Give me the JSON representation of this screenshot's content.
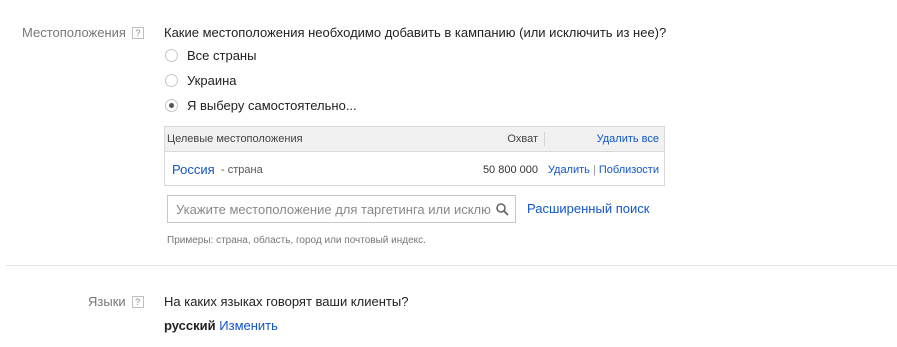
{
  "locations": {
    "label": "Местоположения",
    "help": "?",
    "question": "Какие местоположения необходимо добавить в кампанию (или исключить из нее)?",
    "options": [
      {
        "label": "Все страны",
        "selected": false
      },
      {
        "label": "Украина",
        "selected": false
      },
      {
        "label": "Я выберу самостоятельно...",
        "selected": true
      }
    ],
    "table": {
      "col_target": "Целевые местоположения",
      "col_reach": "Охват",
      "remove_all": "Удалить все",
      "rows": [
        {
          "name": "Россия",
          "type": "- страна",
          "reach": "50 800 000",
          "remove": "Удалить",
          "sep": "|",
          "nearby": "Поблизости"
        }
      ]
    },
    "search": {
      "placeholder": "Укажите местоположение для таргетинга или исклю",
      "advanced": "Расширенный поиск"
    },
    "hint": "Примеры: страна, область, город или почтовый индекс."
  },
  "languages": {
    "label": "Языки",
    "help": "?",
    "question": "На каких языках говорят ваши клиенты?",
    "value": "русский",
    "change": "Изменить"
  }
}
